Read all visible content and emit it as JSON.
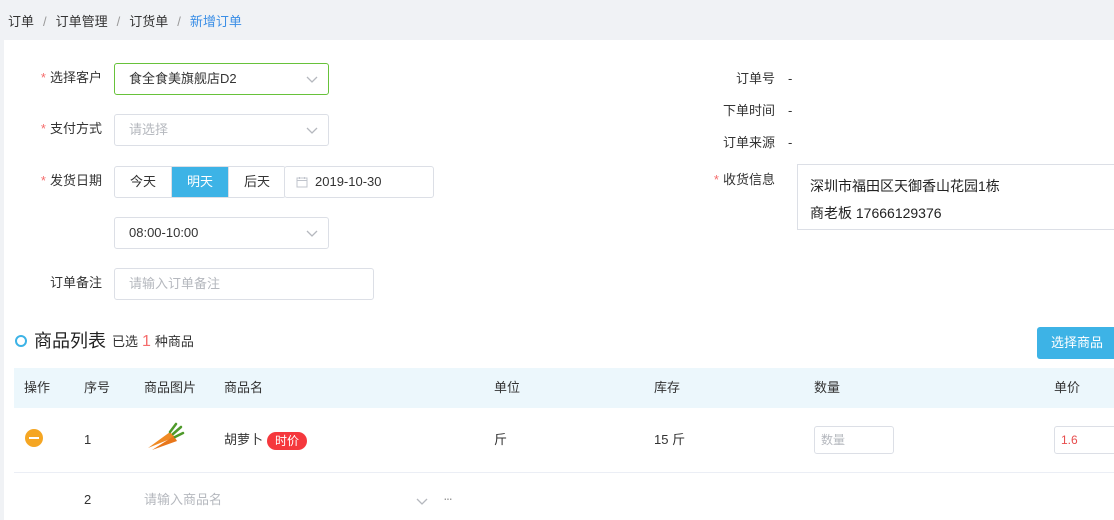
{
  "breadcrumb": {
    "items": [
      "订单",
      "订单管理",
      "订货单"
    ],
    "current": "新增订单"
  },
  "form": {
    "customer": {
      "label": "选择客户",
      "value": "食全食美旗舰店D2"
    },
    "payment": {
      "label": "支付方式",
      "placeholder": "请选择"
    },
    "ship_date": {
      "label": "发货日期",
      "options": [
        "今天",
        "明天",
        "后天"
      ],
      "selected": "明天",
      "date": "2019-10-30",
      "time_slot": "08:00-10:00"
    },
    "remark": {
      "label": "订单备注",
      "placeholder": "请输入订单备注"
    }
  },
  "order_info": {
    "order_no": {
      "label": "订单号",
      "value": "-"
    },
    "order_time": {
      "label": "下单时间",
      "value": "-"
    },
    "order_source": {
      "label": "订单来源",
      "value": "-"
    },
    "receiver": {
      "label": "收货信息",
      "address": "深圳市福田区天御香山花园1栋",
      "contact": "商老板 17666129376"
    }
  },
  "goods": {
    "title": "商品列表",
    "selected_prefix": "已选",
    "selected_count": "1",
    "selected_suffix": "种商品",
    "select_button": "选择商品",
    "columns": [
      "操作",
      "序号",
      "商品图片",
      "商品名",
      "单位",
      "库存",
      "数量",
      "单价"
    ],
    "rows": [
      {
        "index": "1",
        "name": "胡萝卜",
        "tag": "时价",
        "unit": "斤",
        "stock": "15 斤",
        "qty_placeholder": "数量",
        "price": "1.6"
      }
    ],
    "new_row": {
      "index": "2",
      "name_placeholder": "请输入商品名",
      "more": "···"
    }
  },
  "colors": {
    "accent": "#3db3e6",
    "required": "#f56c6c",
    "tag": "#f5383d",
    "remove": "#f5a623"
  },
  "icons": [
    "chevron-down-icon",
    "calendar-icon",
    "circle-dot-icon",
    "minus-circle-icon",
    "carrot-image",
    "ellipsis-icon"
  ]
}
